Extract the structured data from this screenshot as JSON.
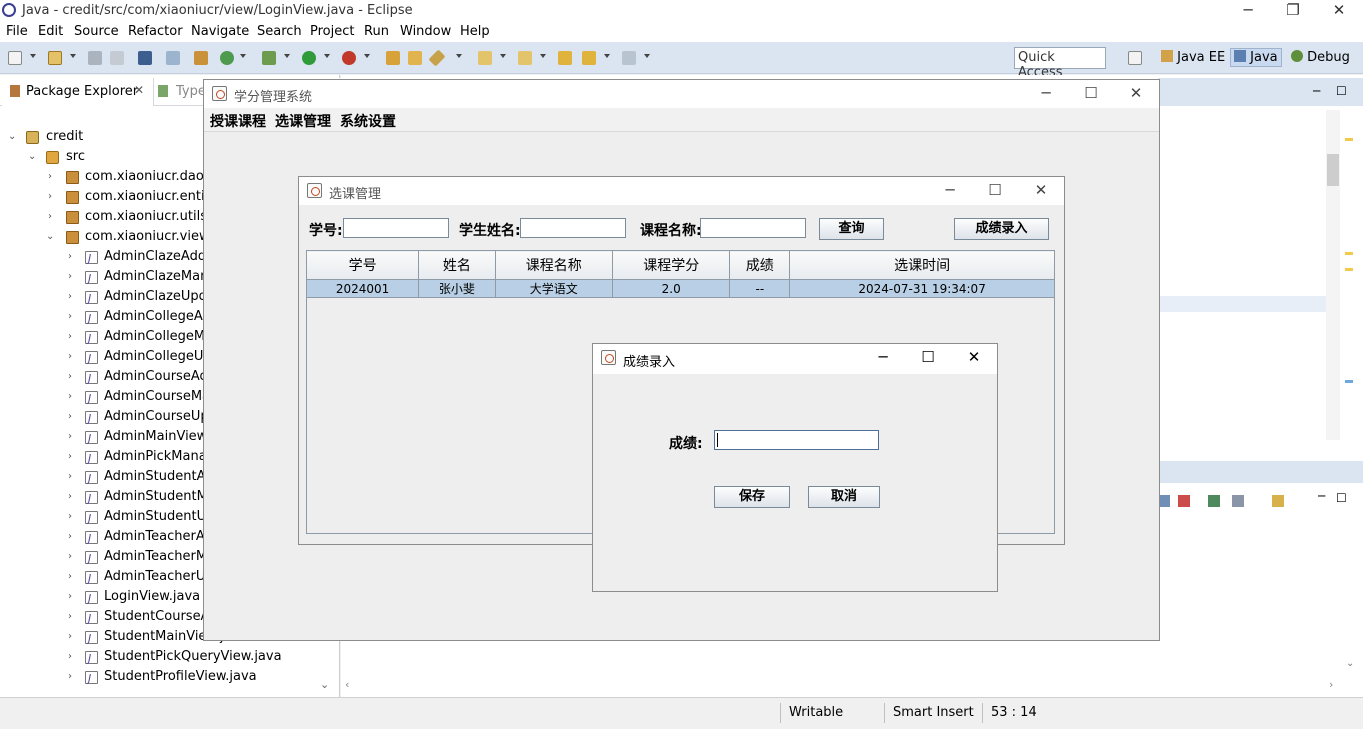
{
  "eclipse": {
    "title": "Java - credit/src/com/xiaoniucr/view/LoginView.java - Eclipse",
    "menu": [
      "File",
      "Edit",
      "Source",
      "Refactor",
      "Navigate",
      "Search",
      "Project",
      "Run",
      "Window",
      "Help"
    ],
    "quick_access": "Quick Access",
    "perspectives": [
      "Java EE",
      "Java",
      "Debug"
    ],
    "package_explorer_tab": "Package Explorer",
    "type_hierarchy_tab": "Type",
    "tree": {
      "project": "credit",
      "src": "src",
      "packages": [
        "com.xiaoniucr.dao",
        "com.xiaoniucr.entity",
        "com.xiaoniucr.utils",
        "com.xiaoniucr.view"
      ],
      "files": [
        "AdminClazeAddV",
        "AdminClazeMana",
        "AdminClazeUpda",
        "AdminCollegeAdd",
        "AdminCollegeMa",
        "AdminCollegeUpc",
        "AdminCourseAdd",
        "AdminCourseMan",
        "AdminCourseUpc",
        "AdminMainView.j",
        "AdminPickManag",
        "AdminStudentAdd",
        "AdminStudentMa",
        "AdminStudentUpc",
        "AdminTeacherAd",
        "AdminTeacherMa",
        "AdminTeacherUp",
        "LoginView.java",
        "StudentCourseAll",
        "StudentMainView.java",
        "StudentPickQueryView.java",
        "StudentProfileView.java"
      ]
    },
    "status": {
      "writable": "Writable",
      "insert_mode": "Smart Insert",
      "position": "53 : 14"
    }
  },
  "main_window": {
    "title": "学分管理系统",
    "menu": [
      "授课课程",
      "选课管理",
      "系统设置"
    ]
  },
  "pick_window": {
    "title": "选课管理",
    "labels": {
      "student_no": "学号:",
      "student_name": "学生姓名:",
      "course_name": "课程名称:"
    },
    "inputs": {
      "student_no": "",
      "student_name": "",
      "course_name": ""
    },
    "query_button": "查询",
    "score_button": "成绩录入",
    "table": {
      "columns": [
        "学号",
        "姓名",
        "课程名称",
        "课程学分",
        "成绩",
        "选课时间"
      ],
      "rows": [
        [
          "2024001",
          "张小斐",
          "大学语文",
          "2.0",
          "--",
          "2024-07-31 19:34:07"
        ]
      ]
    }
  },
  "score_dialog": {
    "title": "成绩录入",
    "label": "成绩:",
    "value": "",
    "save_button": "保存",
    "cancel_button": "取消"
  },
  "colors": {
    "toolbar": "#dbe5f1",
    "selected_row": "#b8cfe5",
    "frame_bg": "#eeeeee"
  }
}
